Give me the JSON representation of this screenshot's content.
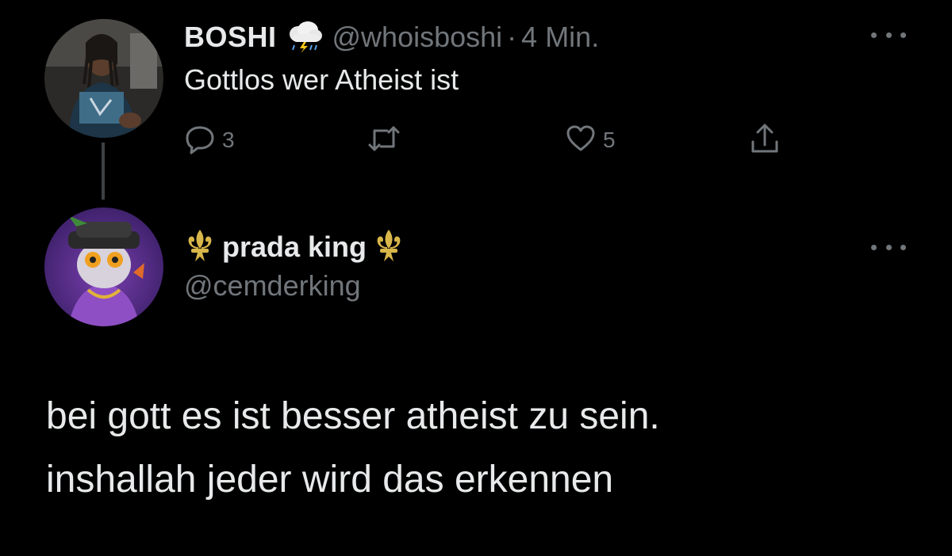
{
  "colors": {
    "background": "#000000",
    "primary_text": "#e7e9ea",
    "secondary_text": "#71767b",
    "thread_line": "#3e4144",
    "fleur_gold": "#d8b64a"
  },
  "parent_tweet": {
    "display_name": "BOSHI",
    "name_icon": "cloud-storm-icon",
    "handle": "@whoisboshi",
    "separator": "·",
    "time": "4 Min.",
    "text": "Gottlos wer Atheist ist",
    "actions": {
      "reply_icon": "reply-icon",
      "reply_count": "3",
      "retweet_icon": "retweet-icon",
      "like_icon": "heart-icon",
      "like_count": "5",
      "share_icon": "share-icon"
    },
    "more_icon": "more-icon"
  },
  "reply_tweet": {
    "display_name": "prada king",
    "name_left_icon": "fleur-de-lis-icon",
    "name_right_icon": "fleur-de-lis-icon",
    "handle": "@cemderking",
    "text_lines": [
      "bei gott es ist besser atheist zu sein.",
      "inshallah jeder wird das erkennen"
    ],
    "more_icon": "more-icon"
  }
}
